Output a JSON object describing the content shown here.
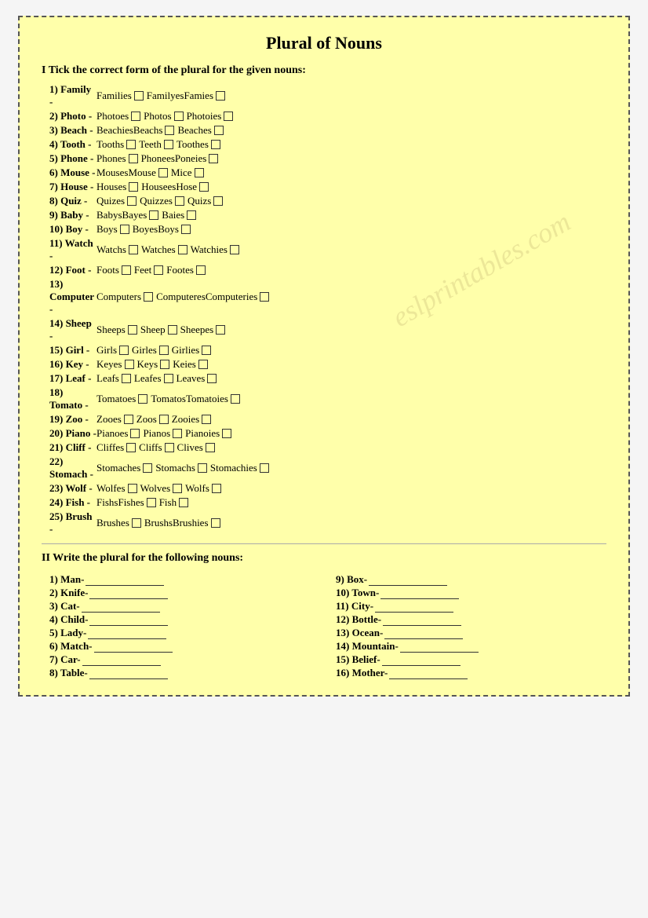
{
  "title": "Plural of Nouns",
  "section1_header": "I Tick the correct form of the plural for the given nouns:",
  "rows": [
    {
      "num": "1) Family",
      "dash": "-",
      "options": [
        "Families",
        "FamilyesFamies",
        ""
      ]
    },
    {
      "num": "2) Photo",
      "dash": "-",
      "options": [
        "Photoes",
        "Photos",
        "Photoies"
      ]
    },
    {
      "num": "3) Beach",
      "dash": "-",
      "options": [
        "BeachiesBeachs",
        "Beaches",
        ""
      ]
    },
    {
      "num": "4) Tooth",
      "dash": "-",
      "options": [
        "Tooths",
        "Teeth",
        "Toothes"
      ]
    },
    {
      "num": "5) Phone",
      "dash": "-",
      "options": [
        "Phones",
        "PhoneesPoneies",
        ""
      ]
    },
    {
      "num": "6) Mouse",
      "dash": "-",
      "options": [
        "MousesMouse",
        "Mice",
        ""
      ]
    },
    {
      "num": "7) House",
      "dash": "-",
      "options": [
        "Houses",
        "HouseesHose",
        ""
      ]
    },
    {
      "num": "8) Quiz",
      "dash": "-",
      "options": [
        "Quizes",
        "Quizzes",
        "Quizs"
      ]
    },
    {
      "num": "9) Baby",
      "dash": "-",
      "options": [
        "BabysBayes",
        "Baies",
        ""
      ]
    },
    {
      "num": "10) Boy",
      "dash": "-",
      "options": [
        "Boys",
        "BoyesBoys",
        ""
      ]
    },
    {
      "num": "11) Watch",
      "dash": "-",
      "options": [
        "Watchs",
        "Watches",
        "Watchies"
      ]
    },
    {
      "num": "12) Foot",
      "dash": "-",
      "options": [
        "Foots",
        "Feet",
        "Footes"
      ]
    },
    {
      "num": "13) Computer",
      "dash": "-",
      "options": [
        "Computers",
        "ComputeresComputeries",
        ""
      ]
    },
    {
      "num": "14) Sheep",
      "dash": "-",
      "options": [
        "Sheeps",
        "Sheep",
        "Sheepes"
      ]
    },
    {
      "num": "15) Girl",
      "dash": "-",
      "options": [
        "Girls",
        "Girles",
        "Girlies"
      ]
    },
    {
      "num": "16) Key",
      "dash": "-",
      "options": [
        "Keyes",
        "Keys",
        "Keies"
      ]
    },
    {
      "num": "17) Leaf",
      "dash": "-",
      "options": [
        "Leafs",
        "Leafes",
        "Leaves"
      ]
    },
    {
      "num": "18) Tomato",
      "dash": "-",
      "options": [
        "Tomatoes",
        "TomatosTomatoies",
        ""
      ]
    },
    {
      "num": "19) Zoo",
      "dash": "-",
      "options": [
        "Zooes",
        "Zoos",
        "Zooies"
      ]
    },
    {
      "num": "20) Piano",
      "dash": "-",
      "options": [
        "Pianoes",
        "Pianos",
        "Pianoies"
      ]
    },
    {
      "num": "21) Cliff",
      "dash": "-",
      "options": [
        "Cliffes",
        "Cliffs",
        "Clives"
      ]
    },
    {
      "num": "22) Stomach",
      "dash": "-",
      "options": [
        "Stomaches",
        "Stomachs",
        "Stomachies"
      ]
    },
    {
      "num": "23) Wolf",
      "dash": "-",
      "options": [
        "Wolfes",
        "Wolves",
        "Wolfs"
      ]
    },
    {
      "num": "24) Fish",
      "dash": "-",
      "options": [
        "FishsFishes",
        "Fish",
        ""
      ]
    },
    {
      "num": "25) Brush",
      "dash": "-",
      "options": [
        "Brushes",
        "BrushsBrushies",
        ""
      ]
    }
  ],
  "section2_header": "II Write the plural for the following nouns:",
  "write_rows_left": [
    {
      "num": "1)",
      "label": "Man-"
    },
    {
      "num": "2)",
      "label": "Knife-"
    },
    {
      "num": "3)",
      "label": "Cat-"
    },
    {
      "num": "4)",
      "label": "Child-"
    },
    {
      "num": "5)",
      "label": "Lady-"
    },
    {
      "num": "6)",
      "label": "Match-"
    },
    {
      "num": "7)",
      "label": "Car-"
    },
    {
      "num": "8)",
      "label": "Table-"
    }
  ],
  "write_rows_right": [
    {
      "num": "9)",
      "label": "Box-"
    },
    {
      "num": "10)",
      "label": "Town-"
    },
    {
      "num": "11)",
      "label": "City-"
    },
    {
      "num": "12)",
      "label": "Bottle-"
    },
    {
      "num": "13)",
      "label": "Ocean-"
    },
    {
      "num": "14)",
      "label": "Mountain-"
    },
    {
      "num": "15)",
      "label": "Belief-"
    },
    {
      "num": "16)",
      "label": "Mother-"
    }
  ],
  "watermark": "eslprintables.com"
}
